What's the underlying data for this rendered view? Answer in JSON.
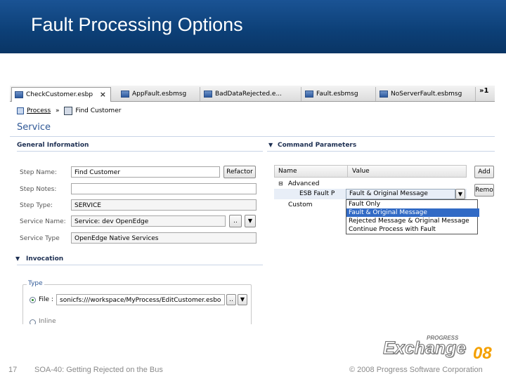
{
  "slide": {
    "title": "Fault Processing Options",
    "page_number": "17",
    "subtitle": "SOA-40: Getting Rejected on the Bus",
    "copyright": "© 2008 Progress Software Corporation",
    "logo": {
      "brand": "PROGRESS",
      "word": "Exchange",
      "year": "08"
    }
  },
  "colors": {
    "header_bg": "#0c3f76",
    "accent_blue": "#2f5896",
    "selection": "#316ac5"
  },
  "tabs": [
    {
      "label": "CheckCustomer.esbp",
      "active": true,
      "close": "×"
    },
    {
      "label": "AppFault.esbmsg"
    },
    {
      "label": "BadDataRejected.e..."
    },
    {
      "label": "Fault.esbmsg"
    },
    {
      "label": "NoServerFault.esbmsg"
    }
  ],
  "tabs_overflow": "»1",
  "breadcrumb": {
    "process": "Process",
    "separator": "»",
    "step": "Find Customer"
  },
  "section_title": "Service",
  "general": {
    "header": "General Information",
    "step_name_label": "Step Name:",
    "step_name_value": "Find Customer",
    "refactor_button": "Refactor",
    "step_notes_label": "Step Notes:",
    "step_notes_value": "",
    "step_type_label": "Step Type:",
    "step_type_value": "SERVICE",
    "service_name_label": "Service Name:",
    "service_name_value": "Service: dev OpenEdge",
    "browse_button": "..",
    "service_type_label": "Service Type",
    "service_type_value": "OpenEdge Native Services"
  },
  "invocation": {
    "header": "Invocation",
    "group_label": "Type",
    "file_label": "File :",
    "file_value": "sonicfs:///workspace/MyProcess/EditCustomer.esbo",
    "browse_button": "..",
    "inline_label": "Inline"
  },
  "command_params": {
    "header": "Command Parameters",
    "col_name": "Name",
    "col_value": "Value",
    "add_button": "Add",
    "remove_button": "Remo",
    "rows": [
      {
        "name": "Advanced",
        "expand": "⊟"
      },
      {
        "name": "ESB Fault P",
        "value": "Fault & Original Message"
      },
      {
        "name": "Custom"
      }
    ],
    "dropdown_options": [
      "Fault Only",
      "Fault & Original Message",
      "Rejected Message & Original Message",
      "Continue Process with Fault"
    ],
    "selected_option": "Fault & Original Message"
  }
}
